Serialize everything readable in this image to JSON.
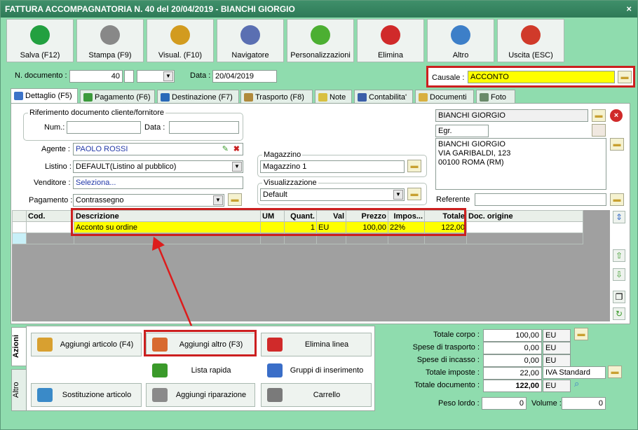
{
  "window": {
    "title": "FATTURA ACCOMPAGNATORIA N. 40 del 20/04/2019 - BIANCHI GIORGIO",
    "close": "×"
  },
  "toolbar": [
    {
      "label": "Salva (F12)",
      "icon": "check-icon",
      "color": "#22a040"
    },
    {
      "label": "Stampa (F9)",
      "icon": "printer-icon",
      "color": "#888888"
    },
    {
      "label": "Visual. (F10)",
      "icon": "magic-wand-icon",
      "color": "#d29b1f"
    },
    {
      "label": "Navigatore",
      "icon": "compass-icon",
      "color": "#5a6fb2"
    },
    {
      "label": "Personalizzazioni",
      "icon": "puzzle-icon",
      "color": "#4caf32"
    },
    {
      "label": "Elimina",
      "icon": "x-icon",
      "color": "#d02a2a"
    },
    {
      "label": "Altro",
      "icon": "magnifier-icon",
      "color": "#3d7fc8"
    },
    {
      "label": "Uscita (ESC)",
      "icon": "power-icon",
      "color": "#d03a2a"
    }
  ],
  "header": {
    "ndoc_label": "N. documento :",
    "ndoc_value": "40",
    "data_label": "Data :",
    "data_value": "20/04/2019",
    "causale_label": "Causale :",
    "causale_value": "ACCONTO"
  },
  "tabs": [
    {
      "label": "Dettaglio (F5)",
      "color": "#3c73c8"
    },
    {
      "label": "Pagamento (F6)",
      "color": "#3c9a3c"
    },
    {
      "label": "Destinazione (F7)",
      "color": "#2a6ab8"
    },
    {
      "label": "Trasporto (F8)",
      "color": "#b08a3c"
    },
    {
      "label": "Note",
      "color": "#d8c040"
    },
    {
      "label": "Contabilita'",
      "color": "#3a5ea8"
    },
    {
      "label": "Documenti",
      "color": "#d8b040"
    },
    {
      "label": "Foto",
      "color": "#6a8a6a"
    }
  ],
  "rif": {
    "title": "Riferimento documento cliente/fornitore",
    "num_label": "Num.:",
    "data_label": "Data :"
  },
  "form": {
    "agente_label": "Agente :",
    "agente_value": "PAOLO ROSSI",
    "listino_label": "Listino :",
    "listino_value": "DEFAULT(Listino al pubblico)",
    "venditore_label": "Venditore :",
    "venditore_value": "Seleziona...",
    "pagamento_label": "Pagamento :",
    "pagamento_value": "Contrassegno",
    "magazzino_title": "Magazzino",
    "magazzino_value": "Magazzino 1",
    "visual_title": "Visualizzazione",
    "visual_value": "Default"
  },
  "cliente": {
    "name": "BIANCHI GIORGIO",
    "prefix": "Egr.",
    "address_line1": "BIANCHI GIORGIO",
    "address_line2": "VIA GARIBALDI, 123",
    "address_line3": "00100 ROMA (RM)",
    "referente_label": "Referente"
  },
  "grid": {
    "columns": [
      "Cod.",
      "Descrizione",
      "UM",
      "Quant.",
      "Val",
      "Prezzo",
      "Impos...",
      "Totale",
      "Doc. origine"
    ],
    "rows": [
      [
        "",
        "Acconto su ordine",
        "",
        "1",
        "EU",
        "100,00",
        "22%",
        "122,00",
        ""
      ]
    ]
  },
  "actions": {
    "azioni_tab": "Azioni",
    "altro_tab": "Altro",
    "buttons": [
      {
        "label": "Aggiungi articolo (F4)",
        "icon": "box-add-icon"
      },
      {
        "label": "Aggiungi altro (F3)",
        "icon": "grid-add-icon"
      },
      {
        "label": "Elimina linea",
        "icon": "delete-x-icon"
      },
      {
        "label": "Lista rapida",
        "icon": "list-add-icon"
      },
      {
        "label": "Gruppi di inserimento",
        "icon": "group-add-icon"
      },
      {
        "label": "Sostituzione articolo",
        "icon": "swap-icon"
      },
      {
        "label": "Aggiungi riparazione",
        "icon": "wrench-icon"
      },
      {
        "label": "Carrello",
        "icon": "cart-icon"
      }
    ]
  },
  "totals": {
    "corpo_label": "Totale corpo :",
    "corpo_value": "100,00",
    "trasporto_label": "Spese di trasporto :",
    "trasporto_value": "0,00",
    "incasso_label": "Spese di incasso :",
    "incasso_value": "0,00",
    "imposte_label": "Totale imposte :",
    "imposte_value": "22,00",
    "iva": "IVA Standard",
    "documento_label": "Totale documento :",
    "documento_value": "122,00",
    "currency": "EU",
    "peso_label": "Peso lordo :",
    "peso_value": "0",
    "volume_label": "Volume :",
    "volume_value": "0"
  }
}
